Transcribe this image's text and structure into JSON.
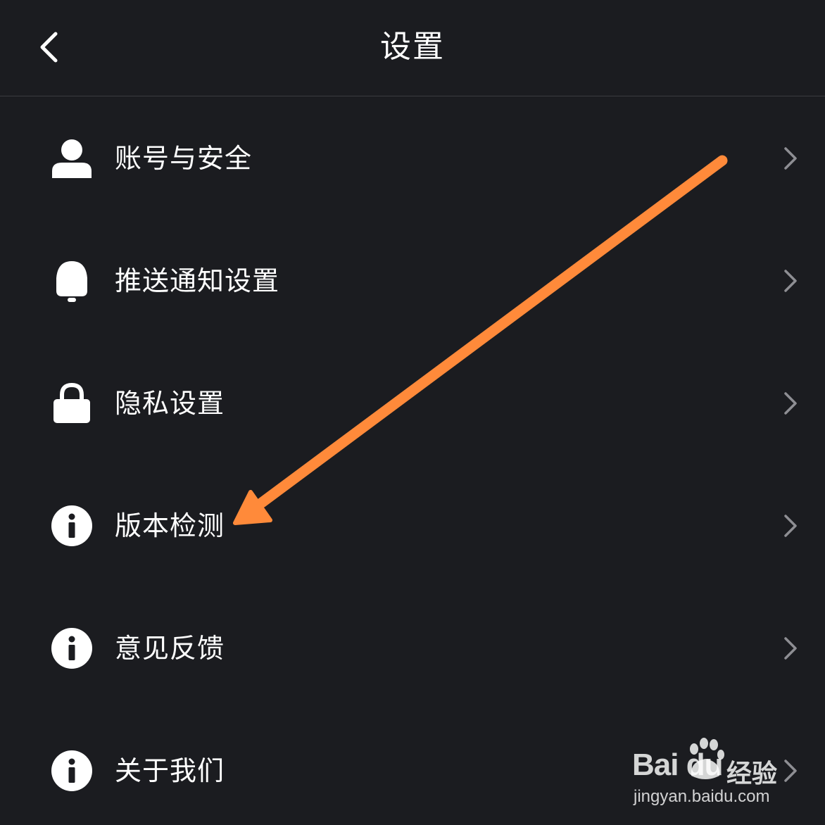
{
  "header": {
    "title": "设置",
    "back_icon": "chevron-left-icon"
  },
  "menu": {
    "items": [
      {
        "label": "账号与安全",
        "icon": "user-icon"
      },
      {
        "label": "推送通知设置",
        "icon": "bell-icon"
      },
      {
        "label": "隐私设置",
        "icon": "lock-icon"
      },
      {
        "label": "版本检测",
        "icon": "info-icon"
      },
      {
        "label": "意见反馈",
        "icon": "info-icon"
      },
      {
        "label": "关于我们",
        "icon": "info-icon"
      }
    ]
  },
  "annotation": {
    "arrow_color": "#ff8a3a",
    "arrow_target": "版本检测"
  },
  "watermark": {
    "brand": "Bai du",
    "product": "经验",
    "url": "jingyan.baidu.com"
  },
  "colors": {
    "background": "#1b1c20",
    "text": "#ffffff",
    "chevron": "#8e8e93",
    "divider": "#3a3b40"
  }
}
